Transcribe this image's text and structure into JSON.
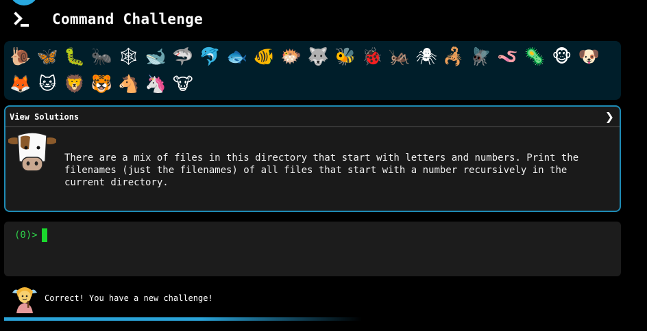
{
  "app": {
    "title": "Command Challenge"
  },
  "animals": [
    {
      "name": "snail-icon",
      "glyph": "🐌"
    },
    {
      "name": "butterfly-icon",
      "glyph": "🦋"
    },
    {
      "name": "caterpillar-icon",
      "glyph": "🐛"
    },
    {
      "name": "ant-icon",
      "glyph": "🐜"
    },
    {
      "name": "spiderweb-icon",
      "glyph": "🕸"
    },
    {
      "name": "whale-icon",
      "glyph": "🐋"
    },
    {
      "name": "shark-icon",
      "glyph": "🦈"
    },
    {
      "name": "dolphin-icon",
      "glyph": "🐬"
    },
    {
      "name": "fish-icon",
      "glyph": "🐟"
    },
    {
      "name": "tropical-fish-icon",
      "glyph": "🐠"
    },
    {
      "name": "blowfish-icon",
      "glyph": "🐡"
    },
    {
      "name": "wolf-icon",
      "glyph": "🐺"
    },
    {
      "name": "bee-icon",
      "glyph": "🐝"
    },
    {
      "name": "ladybug-icon",
      "glyph": "🐞"
    },
    {
      "name": "cricket-icon",
      "glyph": "🦗"
    },
    {
      "name": "spider-icon",
      "glyph": "🕷"
    },
    {
      "name": "scorpion-icon",
      "glyph": "🦂"
    },
    {
      "name": "fly-icon",
      "glyph": "🪰"
    },
    {
      "name": "worm-icon",
      "glyph": "🪱"
    },
    {
      "name": "microbe-icon",
      "glyph": "🦠"
    },
    {
      "name": "monkey-icon",
      "glyph": "🐵"
    },
    {
      "name": "dog-icon",
      "glyph": "🐶"
    },
    {
      "name": "fox-icon",
      "glyph": "🦊"
    },
    {
      "name": "cat-icon",
      "glyph": "🐱"
    },
    {
      "name": "lion-icon",
      "glyph": "🦁"
    },
    {
      "name": "tiger-icon",
      "glyph": "🐯"
    },
    {
      "name": "horse-icon",
      "glyph": "🐴"
    },
    {
      "name": "unicorn-icon",
      "glyph": "🦄"
    },
    {
      "name": "cow-icon",
      "glyph": "🐮"
    }
  ],
  "challenge": {
    "solutions_label": "View Solutions",
    "solutions_chevron": "❯",
    "avatar": "cow-icon",
    "text": "There are a mix of files in this directory that start with letters and numbers. Print the filenames (just the filenames) of all files that start with a number recursively in the current directory."
  },
  "terminal": {
    "prompt": "(0)>",
    "input": ""
  },
  "status": {
    "message": "Correct! You have a new challenge!",
    "avatar": "fairy-icon"
  },
  "progress": {
    "value_percent": 58
  },
  "colors": {
    "accent": "#29a9e0",
    "prompt_green": "#2fd24a",
    "panel_bg": "#001e2a",
    "card_bg": "#1a1a1a",
    "card_border": "#1e8bb5"
  }
}
